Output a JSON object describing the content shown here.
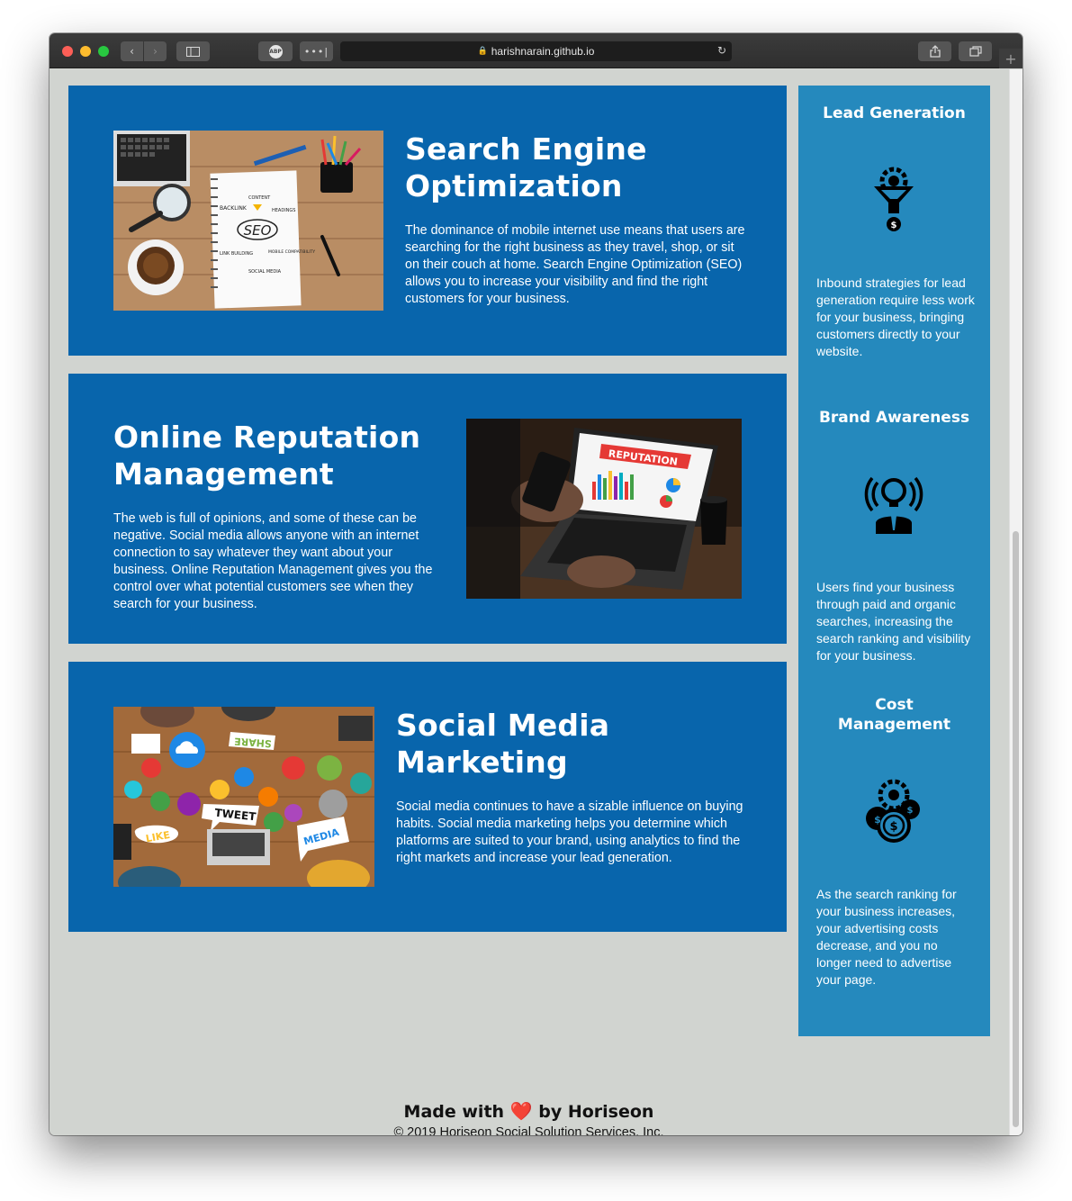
{
  "browser": {
    "url": "harishnarain.github.io",
    "abp_label": "ABP",
    "more_label": "•••|"
  },
  "services": [
    {
      "title_line1": "Search Engine",
      "title_line2": "Optimization",
      "body": "The dominance of mobile internet use means that users are searching for the right business as they travel, shop, or sit on their couch at home. Search Engine Optimization (SEO) allows you to increase your visibility and find the right customers for your business.",
      "image_words": [
        "SEO",
        "BACKLINK",
        "CONTENT",
        "HEADINGS",
        "LINK BUILDING",
        "MOBILE COMPATIBILITY",
        "SOCIAL MEDIA"
      ]
    },
    {
      "title_line1": "Online Reputation",
      "title_line2": "Management",
      "body": "The web is full of opinions, and some of these can be negative. Social media allows anyone with an internet connection to say whatever they want about your business. Online Reputation Management gives you the control over what potential customers see when they search for your business.",
      "image_words": [
        "REPUTATION"
      ]
    },
    {
      "title_line1": "Social Media",
      "title_line2": "Marketing",
      "body": "Social media continues to have a sizable influence on buying habits. Social media marketing helps you determine which platforms are suited to your brand, using analytics to find the right markets and increase your lead generation.",
      "image_words": [
        "SHARE",
        "TWEET",
        "LIKE",
        "MEDIA"
      ]
    }
  ],
  "benefits": [
    {
      "title": "Lead Generation",
      "icon": "lead-generation-icon",
      "body": "Inbound strategies for lead generation require less work for your business, bringing customers directly to your website."
    },
    {
      "title": "Brand Awareness",
      "icon": "brand-awareness-icon",
      "body": "Users find your business through paid and organic searches, increasing the search ranking and visibility for your business."
    },
    {
      "title_line1": "Cost",
      "title_line2": "Management",
      "icon": "cost-management-icon",
      "body": "As the search ranking for your business increases, your advertising costs decrease, and you no longer need to advertise your page."
    }
  ],
  "footer": {
    "made_with": "Made with",
    "by": "by Horiseon",
    "heart": "❤️",
    "copyright": "© 2019 Horiseon Social Solution Services, Inc."
  },
  "colors": {
    "card": "#0865ac",
    "aside": "#2589bd",
    "page": "#d1d4d0"
  }
}
